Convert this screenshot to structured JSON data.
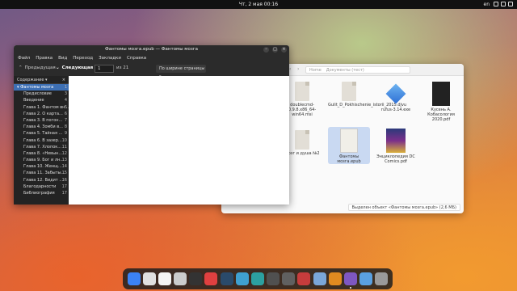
{
  "topbar": {
    "clock": "Чт, 2 мая  00:16",
    "lang": "en"
  },
  "reader": {
    "title": "Фантомы мозга.epub — Фантомы мозга",
    "menu": [
      "Файл",
      "Правка",
      "Вид",
      "Переход",
      "Закладки",
      "Справка"
    ],
    "toolbar": {
      "prev": "Предыдущая",
      "next": "Следующая",
      "page": "1",
      "of_pages": "из 21",
      "zoom": "По ширине страницы"
    },
    "sidebar": {
      "title": "Содержание",
      "root": {
        "label": "Фантомы мозга",
        "page": "1"
      },
      "items": [
        {
          "label": "Предисловие",
          "page": "3"
        },
        {
          "label": "Введение",
          "page": "4"
        },
        {
          "label": "Глава 1. Фантом вн...",
          "page": "5"
        },
        {
          "label": "Глава 2. О карта...",
          "page": "6"
        },
        {
          "label": "Глава 3. В погон...",
          "page": "7"
        },
        {
          "label": "Глава 4. Зомби в...",
          "page": "8"
        },
        {
          "label": "Глава 5. Тайная ...",
          "page": "9"
        },
        {
          "label": "Глава 6. В зазер...",
          "page": "10"
        },
        {
          "label": "Глава 7. Хлопок...",
          "page": "11"
        },
        {
          "label": "Глава 8. «Невын...",
          "page": "12"
        },
        {
          "label": "Глава 9. Бог и лн...",
          "page": "13"
        },
        {
          "label": "Глава 10. Женщ...",
          "page": "14"
        },
        {
          "label": "Глава 11. Забыты...",
          "page": "15"
        },
        {
          "label": "Глава 12. Видит ...",
          "page": "16"
        },
        {
          "label": "Благодарности",
          "page": "17"
        },
        {
          "label": "Библиография",
          "page": "17"
        }
      ]
    }
  },
  "files": {
    "path": [
      "Home",
      "Документы (тест)"
    ],
    "items": [
      {
        "label": "doublecmd-0.9.8.x86_64-win64.msi"
      },
      {
        "label": "Gulit_D_Pokhischenie_istorii_2015.djvu"
      },
      {
        "label": "rufus-3.14.exe"
      },
      {
        "label": "Кусень А. Кобасология 2020.pdf"
      },
      {
        "label": "Мозг и душа №2"
      },
      {
        "label": "Фантомы мозга.epub"
      },
      {
        "label": "Энциклопедия DC Comics.pdf"
      }
    ],
    "status": "Выделен объект «Фантомы мозга.epub» (2,6 МБ)"
  },
  "dock": {
    "apps": [
      "blue-app-icon",
      "vertical-bar-icon",
      "inkscape-icon",
      "obs-icon",
      "terminal-icon",
      "record-icon",
      "steam-icon",
      "browser-icon",
      "update-icon",
      "monitor-icon",
      "keyboard-icon",
      "bag-icon",
      "files-icon",
      "orange-app-icon",
      "reader-icon",
      "photos-icon",
      "grid-icon"
    ],
    "colors": [
      "#3b82f6",
      "#e0e0e0",
      "#f4f4f4",
      "#cccccc",
      "#333333",
      "#e04040",
      "#2a4a6a",
      "#3fa0d0",
      "#2ca0a0",
      "#505050",
      "#606060",
      "#c73c3c",
      "#7aa6d8",
      "#e08a20",
      "#7e57c2",
      "#5aa0e0",
      "#9a9a9a"
    ]
  }
}
